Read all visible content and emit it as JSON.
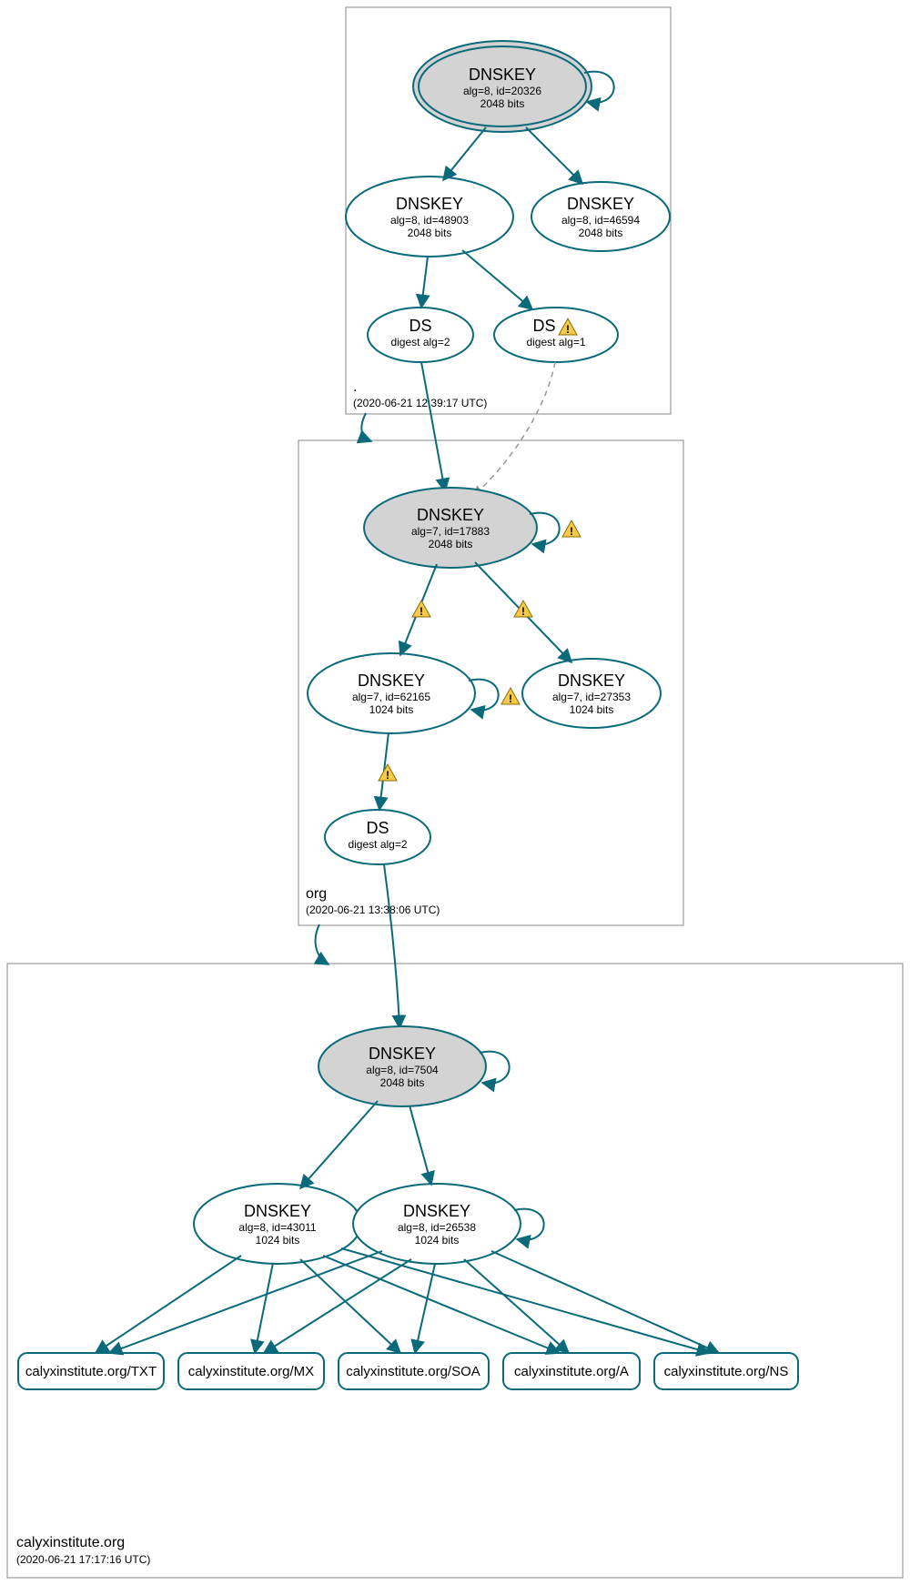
{
  "zones": {
    "root": {
      "name": ".",
      "timestamp": "(2020-06-21 12:39:17 UTC)"
    },
    "org": {
      "name": "org",
      "timestamp": "(2020-06-21 13:38:06 UTC)"
    },
    "leaf": {
      "name": "calyxinstitute.org",
      "timestamp": "(2020-06-21 17:17:16 UTC)"
    }
  },
  "nodes": {
    "root_ksk": {
      "title": "DNSKEY",
      "line1": "alg=8, id=20326",
      "line2": "2048 bits"
    },
    "root_zsk1": {
      "title": "DNSKEY",
      "line1": "alg=8, id=48903",
      "line2": "2048 bits"
    },
    "root_zsk2": {
      "title": "DNSKEY",
      "line1": "alg=8, id=46594",
      "line2": "2048 bits"
    },
    "ds_root1": {
      "title": "DS",
      "line1": "digest alg=2"
    },
    "ds_root2": {
      "title": "DS",
      "line1": "digest alg=1"
    },
    "org_ksk": {
      "title": "DNSKEY",
      "line1": "alg=7, id=17883",
      "line2": "2048 bits"
    },
    "org_zsk1": {
      "title": "DNSKEY",
      "line1": "alg=7, id=62165",
      "line2": "1024 bits"
    },
    "org_zsk2": {
      "title": "DNSKEY",
      "line1": "alg=7, id=27353",
      "line2": "1024 bits"
    },
    "ds_org": {
      "title": "DS",
      "line1": "digest alg=2"
    },
    "leaf_ksk": {
      "title": "DNSKEY",
      "line1": "alg=8, id=7504",
      "line2": "2048 bits"
    },
    "leaf_zsk1": {
      "title": "DNSKEY",
      "line1": "alg=8, id=43011",
      "line2": "1024 bits"
    },
    "leaf_zsk2": {
      "title": "DNSKEY",
      "line1": "alg=8, id=26538",
      "line2": "1024 bits"
    }
  },
  "rrsets": {
    "txt": "calyxinstitute.org/TXT",
    "mx": "calyxinstitute.org/MX",
    "soa": "calyxinstitute.org/SOA",
    "a": "calyxinstitute.org/A",
    "ns": "calyxinstitute.org/NS"
  }
}
